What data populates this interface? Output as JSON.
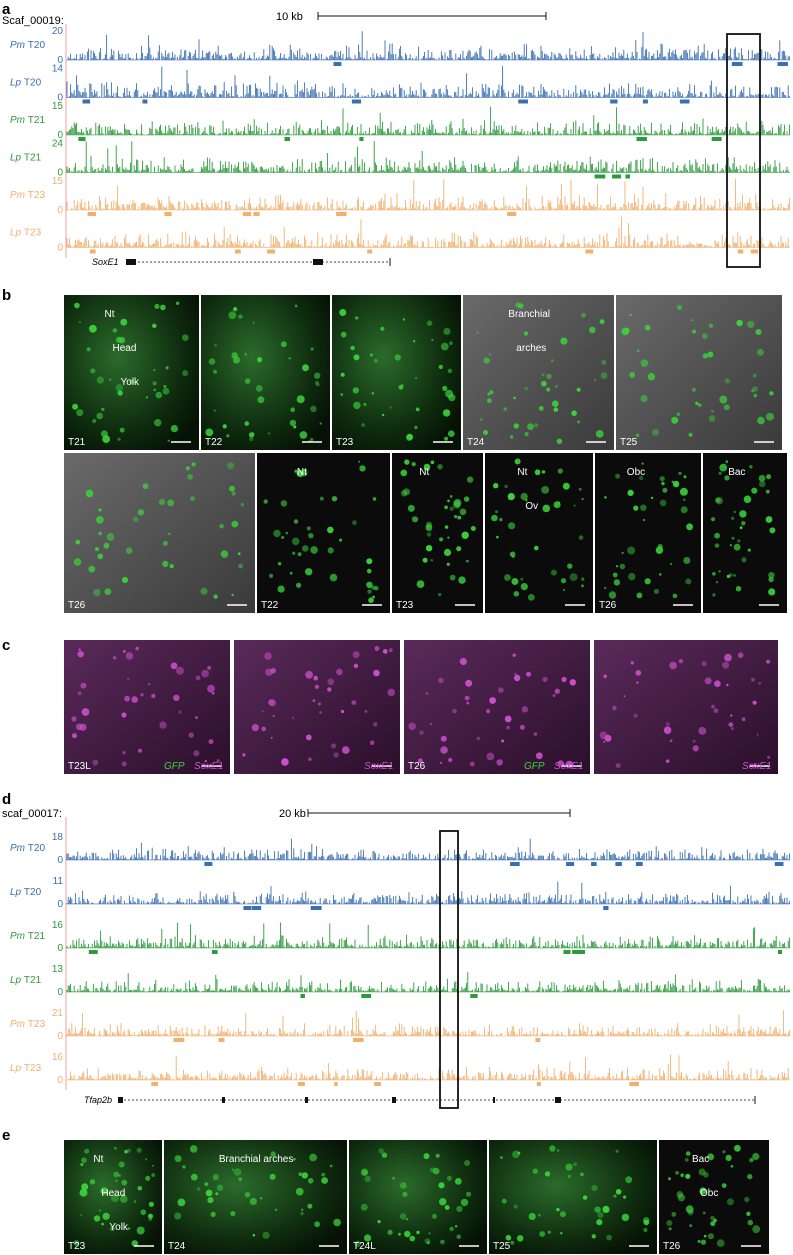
{
  "panels": {
    "a": {
      "letter": "a",
      "scaffold": "Scaf_00019:",
      "scale": "10 kb",
      "gene": "SoxE1",
      "tracks": [
        {
          "sp": "Pm",
          "stage": "T20",
          "max": "20",
          "color": "#3a6fb0"
        },
        {
          "sp": "Lp",
          "stage": "T20",
          "max": "14",
          "color": "#3a6fb0"
        },
        {
          "sp": "Pm",
          "stage": "T21",
          "max": "15",
          "color": "#2e9a3c"
        },
        {
          "sp": "Lp",
          "stage": "T21",
          "max": "24",
          "color": "#2e9a3c"
        },
        {
          "sp": "Pm",
          "stage": "T23",
          "max": "15",
          "color": "#f0b070"
        },
        {
          "sp": "Lp",
          "stage": "T23",
          "max": "",
          "color": "#f0b070"
        }
      ],
      "zero": "0"
    },
    "b": {
      "letter": "b",
      "top_images": [
        {
          "stage": "T21",
          "labels": [
            "Nt",
            "Head",
            "Yolk"
          ]
        },
        {
          "stage": "T22",
          "labels": []
        },
        {
          "stage": "T23",
          "labels": []
        },
        {
          "stage": "T24",
          "labels": [
            "Branchial",
            "arches"
          ]
        },
        {
          "stage": "T25",
          "labels": []
        }
      ],
      "bottom_images": [
        {
          "stage": "T26",
          "labels": []
        },
        {
          "stage": "T22",
          "labels": [
            "Nt"
          ]
        },
        {
          "stage": "T23",
          "labels": [
            "Nt"
          ]
        },
        {
          "stage": "",
          "labels": [
            "Nt",
            "Ov"
          ]
        },
        {
          "stage": "T26",
          "labels": [
            "Obc"
          ]
        },
        {
          "stage": "",
          "labels": [
            "Bac"
          ]
        }
      ]
    },
    "c": {
      "letter": "c",
      "images": [
        {
          "stage": "T23L",
          "gfp": "GFP",
          "sox": "SoxE1"
        },
        {
          "stage": "",
          "gfp": "",
          "sox": "SoxE1"
        },
        {
          "stage": "T26",
          "gfp": "GFP",
          "sox": "SoxE1"
        },
        {
          "stage": "",
          "gfp": "",
          "sox": "SoxE1"
        }
      ]
    },
    "d": {
      "letter": "d",
      "scaffold": "scaf_00017:",
      "scale": "20 kb",
      "gene": "Tfap2b",
      "tracks": [
        {
          "sp": "Pm",
          "stage": "T20",
          "max": "18",
          "color": "#3a6fb0"
        },
        {
          "sp": "Lp",
          "stage": "T20",
          "max": "11",
          "color": "#3a6fb0"
        },
        {
          "sp": "Pm",
          "stage": "T21",
          "max": "16",
          "color": "#2e9a3c"
        },
        {
          "sp": "Lp",
          "stage": "T21",
          "max": "13",
          "color": "#2e9a3c"
        },
        {
          "sp": "Pm",
          "stage": "T23",
          "max": "21",
          "color": "#f0b070"
        },
        {
          "sp": "Lp",
          "stage": "T23",
          "max": "16",
          "color": "#f0b070"
        }
      ],
      "zero": "0"
    },
    "e": {
      "letter": "e",
      "images": [
        {
          "stage": "T23",
          "labels": [
            "Nt",
            "Head",
            "Yolk"
          ]
        },
        {
          "stage": "T24",
          "labels": [
            "Branchial arches"
          ]
        },
        {
          "stage": "T24L",
          "labels": []
        },
        {
          "stage": "T25",
          "labels": []
        },
        {
          "stage": "T26",
          "labels": [
            "Bac",
            "Obc"
          ]
        }
      ]
    }
  }
}
